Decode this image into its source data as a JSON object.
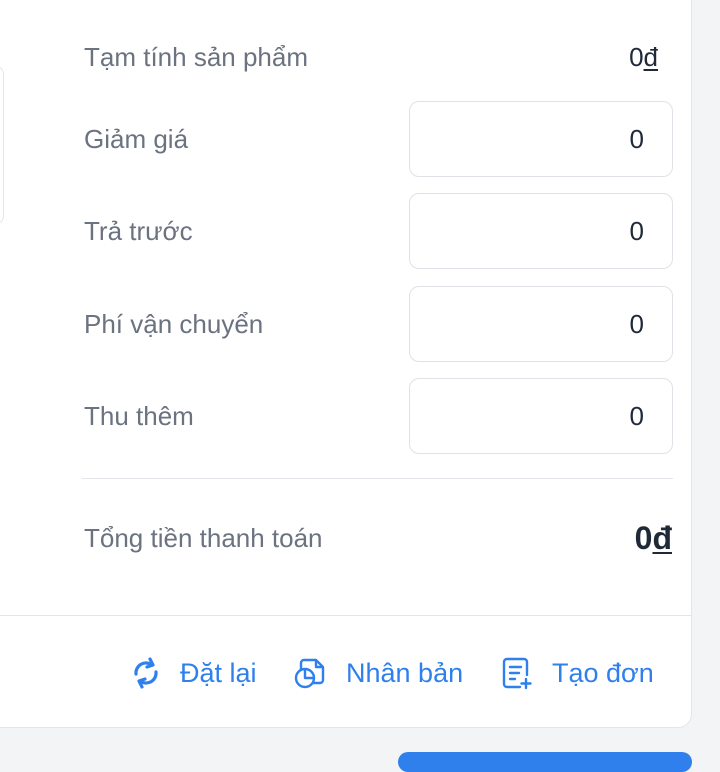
{
  "summary": {
    "subtotal_label": "Tạm tính sản phẩm",
    "subtotal_value": "0",
    "currency": "đ",
    "discount_label": "Giảm giá",
    "discount_value": "0",
    "prepaid_label": "Trả trước",
    "prepaid_value": "0",
    "shipping_label": "Phí vận chuyển",
    "shipping_value": "0",
    "extra_label": "Thu thêm",
    "extra_value": "0",
    "total_label": "Tổng tiền thanh toán",
    "total_value": "0"
  },
  "actions": {
    "reset_label": "Đặt lại",
    "reset_icon": "refresh-icon",
    "duplicate_label": "Nhân bản",
    "duplicate_icon": "duplicate-icon",
    "create_label": "Tạo đơn",
    "create_icon": "create-order-icon"
  },
  "colors": {
    "accent": "#2f80ed",
    "label": "#6b7280",
    "text": "#1f2937",
    "border": "#e3e5ea"
  }
}
